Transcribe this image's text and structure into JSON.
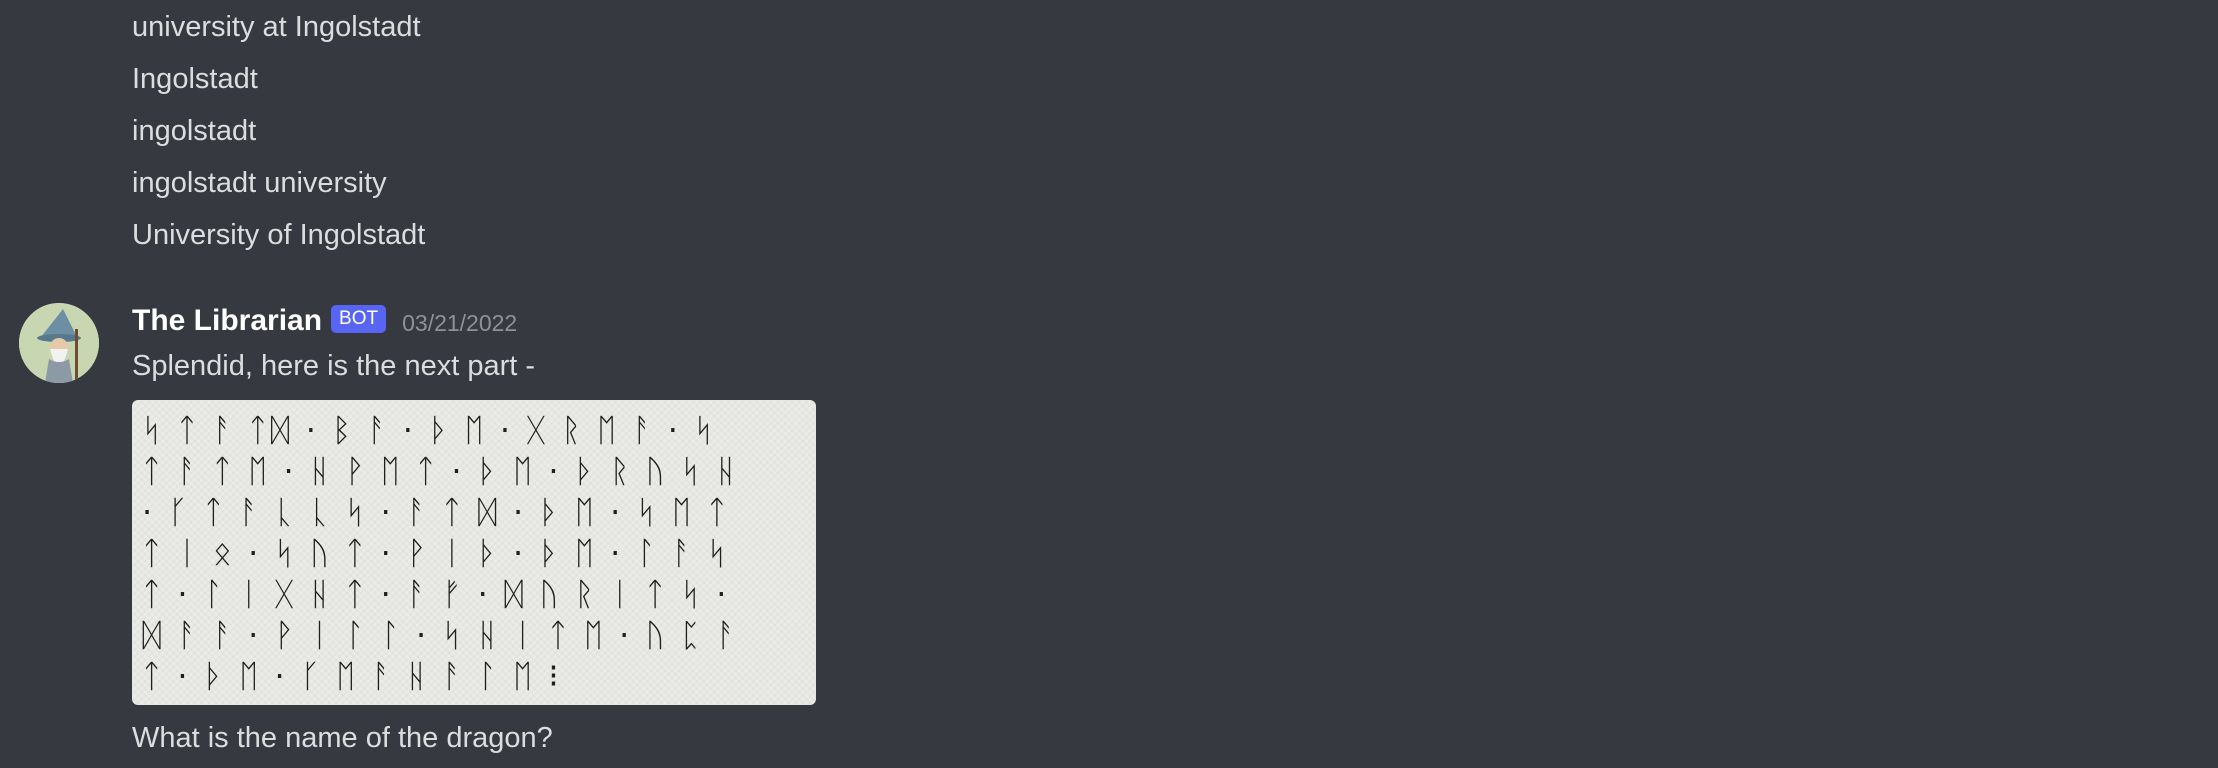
{
  "previous_messages": [
    "university at Ingolstadt",
    "Ingolstadt",
    "ingolstadt",
    "ingolstadt university",
    "University of Ingolstadt"
  ],
  "message": {
    "author": "The Librarian",
    "bot_tag": "BOT",
    "timestamp": "03/21/2022",
    "text": "Splendid, here is the next part -",
    "rune_lines": [
      "ᛋ ᛏ ᚨ ᛏᛞ · ᛒ ᚨ · ᚦ ᛖ · ᚷ ᚱ ᛖ ᚨ · ᛋ",
      "ᛏ ᚨ ᛏ ᛖ · ᚺ ᚹ ᛖ ᛏ · ᚦ ᛖ · ᚦ ᚱ ᚢ ᛋ ᚺ",
      "· ᚴ ᛏ ᚨ ᚳ ᚳ ᛋ · ᚨ ᛏ ᛞ · ᚦ ᛖ · ᛋ ᛖ ᛏ",
      "ᛏ ᛁ ᛟ · ᛋ ᚢ ᛏ · ᚹ ᛁ ᚦ · ᚦ ᛖ · ᛚ ᚨ ᛋ",
      "ᛏ · ᛚ ᛁ ᚷ ᚺ ᛏ · ᚨ ᚠ · ᛞ ᚢ ᚱ ᛁ ᛏ ᛋ ·",
      "ᛞ ᚨ ᚨ · ᚹ ᛁ ᛚ ᛚ · ᛋ ᚺ ᛁ ᛏ ᛖ · ᚢ ᛈ ᚨ",
      "ᛏ · ᚦ ᛖ · ᚴ ᛖ ᚨ ᚺ ᚨ ᛚ ᛖ ⁝"
    ],
    "question": "What is the name of the dragon?"
  }
}
